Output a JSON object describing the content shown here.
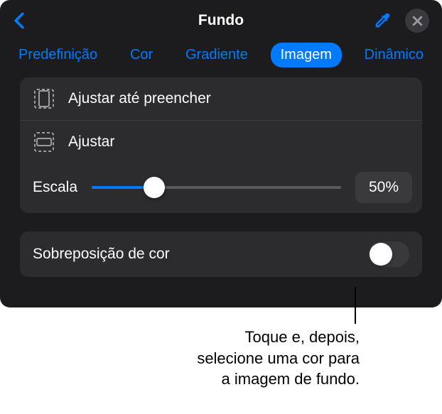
{
  "header": {
    "title": "Fundo"
  },
  "tabs": {
    "preset": "Predefinição",
    "color": "Cor",
    "gradient": "Gradiente",
    "image": "Imagem",
    "dynamic": "Dinâmico"
  },
  "options": {
    "scale_to_fill": "Ajustar até preencher",
    "scale_to_fit": "Ajustar",
    "scale_label": "Escala",
    "scale_value": "50%"
  },
  "overlay": {
    "label": "Sobreposição de cor"
  },
  "callout": {
    "line1": "Toque e, depois,",
    "line2": "selecione uma cor para",
    "line3": "a imagem de fundo."
  }
}
